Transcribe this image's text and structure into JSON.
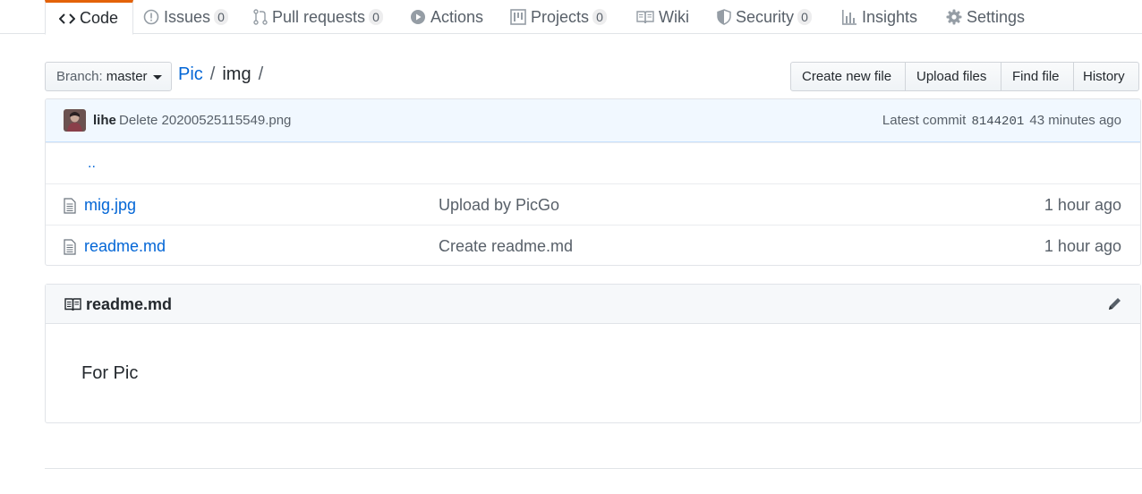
{
  "tabs": [
    {
      "label": "Code",
      "icon": "code-icon",
      "selected": true
    },
    {
      "label": "Issues",
      "icon": "issue-opened-icon",
      "count": "0"
    },
    {
      "label": "Pull requests",
      "icon": "git-pull-request-icon",
      "count": "0"
    },
    {
      "label": "Actions",
      "icon": "play-icon"
    },
    {
      "label": "Projects",
      "icon": "project-icon",
      "count": "0"
    },
    {
      "label": "Wiki",
      "icon": "book-icon"
    },
    {
      "label": "Security",
      "icon": "shield-icon",
      "count": "0"
    },
    {
      "label": "Insights",
      "icon": "graph-icon"
    },
    {
      "label": "Settings",
      "icon": "gear-icon"
    }
  ],
  "branch": {
    "label": "Branch:",
    "value": "master"
  },
  "breadcrumb": {
    "repo": "Pic",
    "separator": "/",
    "folder": "img",
    "trailing": "/"
  },
  "actions": {
    "create_new_file": "Create new file",
    "upload_files": "Upload files",
    "find_file": "Find file",
    "history": "History"
  },
  "commit": {
    "author": "lihe",
    "message": "Delete 20200525115549.png",
    "latest_label": "Latest commit",
    "sha": "8144201",
    "age": "43 minutes ago"
  },
  "files": {
    "up_link": "..",
    "rows": [
      {
        "name": "mig.jpg",
        "message": "Upload by PicGo",
        "age": "1 hour ago"
      },
      {
        "name": "readme.md",
        "message": "Create readme.md",
        "age": "1 hour ago"
      }
    ]
  },
  "readme": {
    "title": "readme.md",
    "body": "For Pic"
  },
  "colors": {
    "link": "#0366d6",
    "tab_accent": "#e36209",
    "commit_bg": "#f1f8ff",
    "muted": "#586069"
  }
}
